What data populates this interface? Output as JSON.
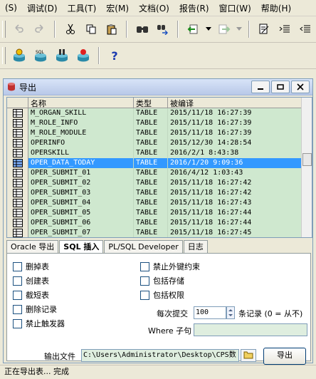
{
  "menu": [
    {
      "label": "(S)",
      "key": "s"
    },
    {
      "label": "调试(D)",
      "key": "debug"
    },
    {
      "label": "工具(T)",
      "key": "tools"
    },
    {
      "label": "宏(M)",
      "key": "macro"
    },
    {
      "label": "文档(O)",
      "key": "docs"
    },
    {
      "label": "报告(R)",
      "key": "report"
    },
    {
      "label": "窗口(W)",
      "key": "window"
    },
    {
      "label": "帮助(H)",
      "key": "help"
    }
  ],
  "window": {
    "title": "导出"
  },
  "grid": {
    "columns": [
      "名称",
      "类型",
      "被编译"
    ],
    "rows": [
      {
        "name": "M_ORGAN_SKILL",
        "type": "TABLE",
        "compiled": "2015/11/18 16:27:39",
        "selected": false
      },
      {
        "name": "M_ROLE_INFO",
        "type": "TABLE",
        "compiled": "2015/11/18 16:27:39",
        "selected": false
      },
      {
        "name": "M_ROLE_MODULE",
        "type": "TABLE",
        "compiled": "2015/11/18 16:27:39",
        "selected": false
      },
      {
        "name": "OPERINFO",
        "type": "TABLE",
        "compiled": "2015/12/30 14:28:54",
        "selected": false
      },
      {
        "name": "OPERSKILL",
        "type": "TABLE",
        "compiled": "2016/2/1 8:43:38",
        "selected": false
      },
      {
        "name": "OPER_DATA_TODAY",
        "type": "TABLE",
        "compiled": "2016/1/20 9:09:36",
        "selected": true
      },
      {
        "name": "OPER_SUBMIT_01",
        "type": "TABLE",
        "compiled": "2016/4/12 1:03:43",
        "selected": false
      },
      {
        "name": "OPER_SUBMIT_02",
        "type": "TABLE",
        "compiled": "2015/11/18 16:27:42",
        "selected": false
      },
      {
        "name": "OPER_SUBMIT_03",
        "type": "TABLE",
        "compiled": "2015/11/18 16:27:42",
        "selected": false
      },
      {
        "name": "OPER_SUBMIT_04",
        "type": "TABLE",
        "compiled": "2015/11/18 16:27:43",
        "selected": false
      },
      {
        "name": "OPER_SUBMIT_05",
        "type": "TABLE",
        "compiled": "2015/11/18 16:27:44",
        "selected": false
      },
      {
        "name": "OPER_SUBMIT_06",
        "type": "TABLE",
        "compiled": "2015/11/18 16:27:44",
        "selected": false
      },
      {
        "name": "OPER_SUBMIT_07",
        "type": "TABLE",
        "compiled": "2015/11/18 16:27:45",
        "selected": false
      }
    ]
  },
  "tabs": [
    {
      "label": "Oracle 导出",
      "active": false
    },
    {
      "label": "SQL 插入",
      "active": true
    },
    {
      "label": "PL/SQL Developer",
      "active": false
    },
    {
      "label": "日志",
      "active": false
    }
  ],
  "options": {
    "drop_tables": "删掉表",
    "create_tables": "创建表",
    "truncate_tables": "截短表",
    "delete_records": "删除记录",
    "disable_triggers": "禁止触发器",
    "disable_fk": "禁止外键约束",
    "include_storage": "包括存储",
    "include_privileges": "包括权限"
  },
  "commit": {
    "label": "每次提交",
    "value": "100",
    "suffix": "条记录 (0 = 从不)"
  },
  "where": {
    "label": "Where 子句",
    "value": ""
  },
  "output": {
    "label": "输出文件",
    "path": "C:\\Users\\Administrator\\Desktop\\CPS数",
    "export_button": "导出"
  },
  "status": "正在导出表... 完成",
  "colors": {
    "row_green": "#cfe8cf",
    "row_selected": "#3399ff",
    "frame": "#ece9d8"
  }
}
